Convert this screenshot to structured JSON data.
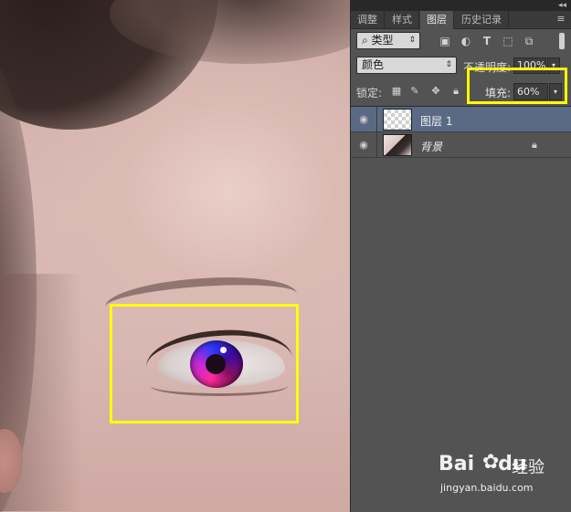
{
  "canvas": {
    "description_icon": "portrait-eye-photo"
  },
  "panel": {
    "tabs": [
      {
        "label": "调整"
      },
      {
        "label": "样式"
      },
      {
        "label": "图层"
      },
      {
        "label": "历史记录"
      }
    ],
    "filter": {
      "label": "类型",
      "icons": [
        "image-filter-icon",
        "adjustment-filter-icon",
        "text-filter-icon",
        "shape-filter-icon",
        "smart-object-filter-icon"
      ]
    },
    "blend": {
      "mode": "颜色",
      "opacity_label": "不透明度:",
      "opacity_value": "100%"
    },
    "lock": {
      "label": "锁定:",
      "fill_label": "填充:",
      "fill_value": "60%"
    },
    "layers": [
      {
        "name": "图层 1",
        "selected": true,
        "thumb": "transparent"
      },
      {
        "name": "背景",
        "selected": false,
        "thumb": "photo",
        "locked": true
      }
    ]
  },
  "watermark": {
    "logo": "Bai",
    "suffix": "du",
    "product": "经验",
    "url": "jingyan.baidu.com"
  },
  "colors": {
    "highlight": "#ffff00",
    "selected_layer": "#5a6a84",
    "panel_bg": "#535353"
  }
}
